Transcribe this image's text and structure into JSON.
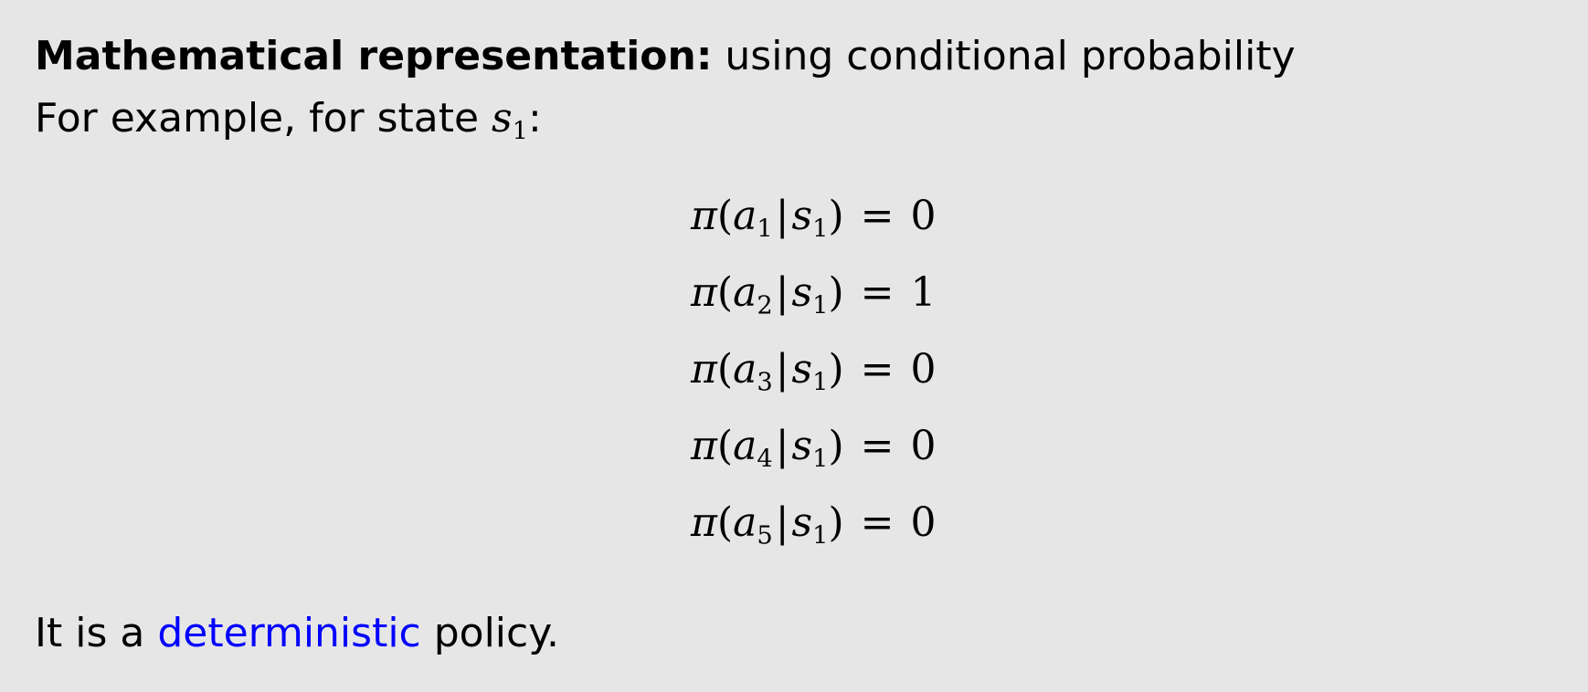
{
  "heading": {
    "bold": "Mathematical representation:",
    "rest": " using conditional probability"
  },
  "example": {
    "prefix": "For example, for state ",
    "state_var": "s",
    "state_sub": "1",
    "suffix": ":"
  },
  "equations": [
    {
      "func": "π",
      "action": "a",
      "action_sub": "1",
      "state": "s",
      "state_sub": "1",
      "value": "0"
    },
    {
      "func": "π",
      "action": "a",
      "action_sub": "2",
      "state": "s",
      "state_sub": "1",
      "value": "1"
    },
    {
      "func": "π",
      "action": "a",
      "action_sub": "3",
      "state": "s",
      "state_sub": "1",
      "value": "0"
    },
    {
      "func": "π",
      "action": "a",
      "action_sub": "4",
      "state": "s",
      "state_sub": "1",
      "value": "0"
    },
    {
      "func": "π",
      "action": "a",
      "action_sub": "5",
      "state": "s",
      "state_sub": "1",
      "value": "0"
    }
  ],
  "conclusion": {
    "prefix": "It is a ",
    "link": "deterministic",
    "suffix": " policy."
  },
  "colors": {
    "background": "#e6e6e6",
    "text": "#000000",
    "link": "#0000ff"
  }
}
